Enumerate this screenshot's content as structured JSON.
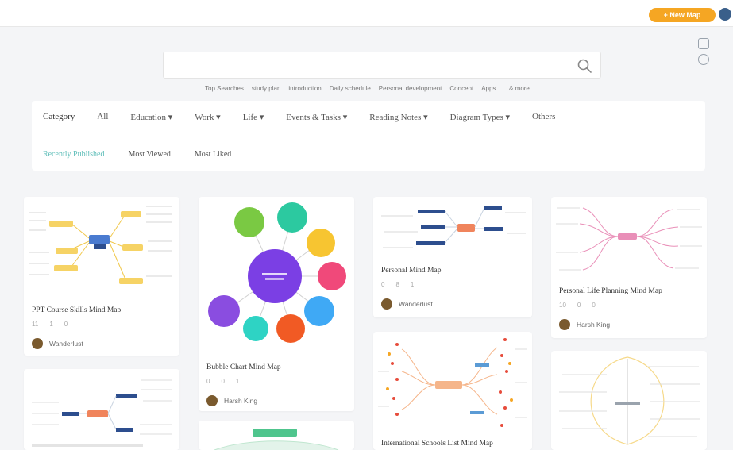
{
  "header": {
    "new_button_label": "+ New Map",
    "tool_icons": [
      "grid-icon",
      "refresh-icon"
    ]
  },
  "search": {
    "placeholder": "",
    "hot_tags": [
      "Top Searches",
      "study plan",
      "introduction",
      "Daily schedule",
      "Personal development",
      "Concept",
      "Apps",
      "...& more"
    ]
  },
  "filters": {
    "category_label": "Category",
    "all_label": "All",
    "items": [
      "Education ▾",
      "Work ▾",
      "Life ▾",
      "Events & Tasks ▾",
      "Reading Notes ▾",
      "Diagram Types ▾",
      "Others"
    ],
    "sub_tabs": [
      "Recently Published",
      "Most Viewed",
      "Most Liked"
    ]
  },
  "cards": [
    {
      "title": "PPT Course Skills Mind Map",
      "views": "11",
      "likes": "1",
      "comments": "0",
      "author": "Wanderlust"
    },
    {
      "title": "Bubble Chart Mind Map",
      "views": "0",
      "likes": "0",
      "comments": "1",
      "author": "Harsh King"
    },
    {
      "title": "Personal Mind Map",
      "views": "0",
      "likes": "8",
      "comments": "1",
      "author": "Wanderlust"
    },
    {
      "title": "Personal Life Planning Mind Map",
      "views": "10",
      "likes": "0",
      "comments": "0",
      "author": "Harsh King"
    },
    {
      "title": "",
      "views": "",
      "likes": "",
      "comments": "",
      "author": ""
    },
    {
      "title": "",
      "views": "",
      "likes": "",
      "comments": "",
      "author": ""
    },
    {
      "title": "International Schools List Mind Map",
      "views": "",
      "likes": "",
      "comments": "",
      "author": ""
    },
    {
      "title": "",
      "views": "",
      "likes": "",
      "comments": "",
      "author": ""
    }
  ],
  "colors": {
    "accent_orange": "#f5a623",
    "active_tab": "#5cbdb8",
    "bubble_center": "#7b3fe4",
    "bubble_colors": [
      "#7ac943",
      "#2cc9a0",
      "#f7c531",
      "#f0497a",
      "#3fa9f5",
      "#f15a24",
      "#2ed3c4",
      "#8a4de0"
    ]
  }
}
